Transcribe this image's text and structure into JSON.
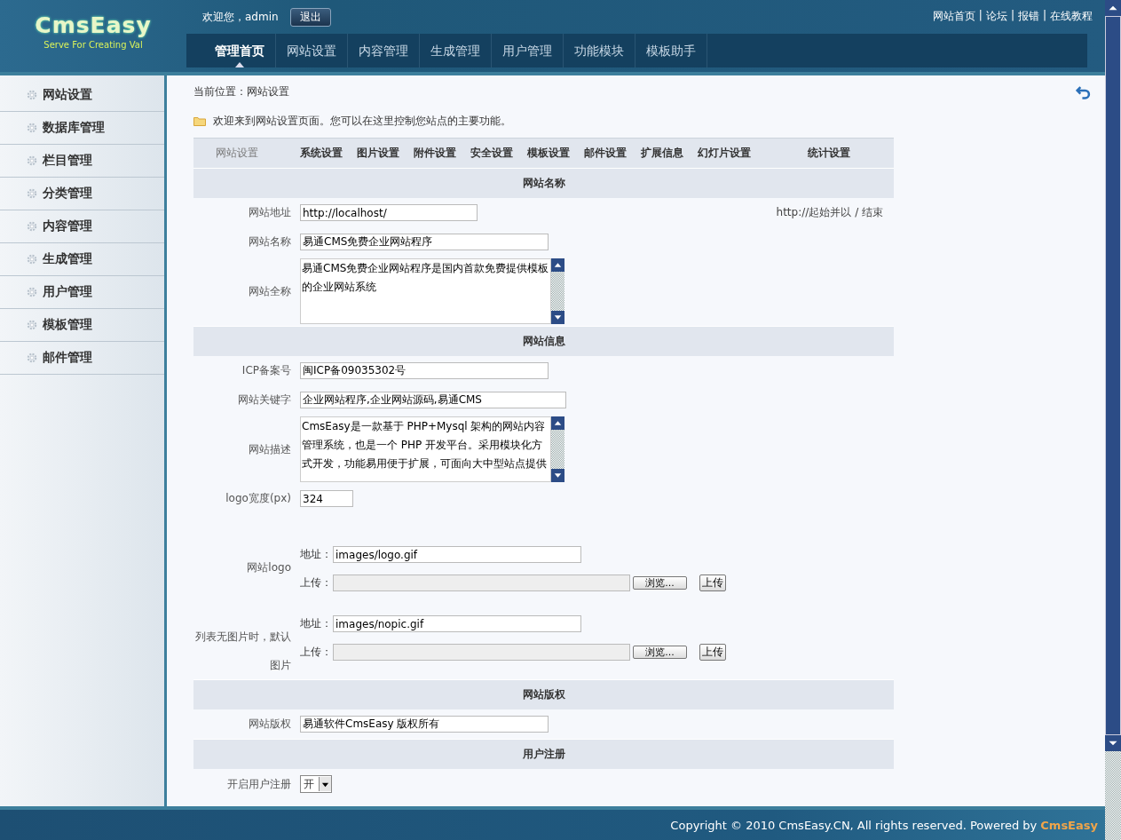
{
  "logo": {
    "name": "CmsEasy",
    "slogan": "Serve For Creating Val"
  },
  "user_bar": {
    "greeting": "欢迎您，admin",
    "logout": "退出"
  },
  "top_links": {
    "separator": "|",
    "items": [
      "网站首页",
      "论坛",
      "报错",
      "在线教程"
    ]
  },
  "main_nav": [
    {
      "label": "管理首页",
      "selected": true
    },
    {
      "label": "网站设置",
      "selected": false
    },
    {
      "label": "内容管理",
      "selected": false
    },
    {
      "label": "生成管理",
      "selected": false
    },
    {
      "label": "用户管理",
      "selected": false
    },
    {
      "label": "功能模块",
      "selected": false
    },
    {
      "label": "模板助手",
      "selected": false
    }
  ],
  "sidebar": {
    "items": [
      "网站设置",
      "数据库管理",
      "栏目管理",
      "分类管理",
      "内容管理",
      "生成管理",
      "用户管理",
      "模板管理",
      "邮件管理"
    ]
  },
  "breadcrumb": "当前位置：网站设置",
  "intro": "欢迎来到网站设置页面。您可以在这里控制您站点的主要功能。",
  "settings_tabs": [
    {
      "label": "网站设置",
      "selected": true
    },
    {
      "label": "系统设置",
      "selected": false
    },
    {
      "label": "图片设置",
      "selected": false
    },
    {
      "label": "附件设置",
      "selected": false
    },
    {
      "label": "安全设置",
      "selected": false
    },
    {
      "label": "模板设置",
      "selected": false
    },
    {
      "label": "邮件设置",
      "selected": false
    },
    {
      "label": "扩展信息",
      "selected": false
    },
    {
      "label": "幻灯片设置",
      "selected": false
    },
    {
      "label": "统计设置",
      "selected": false
    }
  ],
  "sections": [
    {
      "title": "网站名称",
      "rows": [
        {
          "kind": "url",
          "label": "网站地址",
          "value": "http://localhost/",
          "hint": "http://起始并以 / 结束"
        },
        {
          "kind": "text",
          "label": "网站名称",
          "value": "易通CMS免费企业网站程序"
        },
        {
          "kind": "textarea",
          "label": "网站全称",
          "value": "易通CMS免费企业网站程序是国内首款免费提供模板的企业网站系统"
        }
      ]
    },
    {
      "title": "网站信息",
      "rows": [
        {
          "kind": "text",
          "label": "ICP备案号",
          "value": "闽ICP备09035302号"
        },
        {
          "kind": "wide",
          "label": "网站关键字",
          "value": "企业网站程序,企业网站源码,易通CMS"
        },
        {
          "kind": "textarea",
          "label": "网站描述",
          "value": "CmsEasy是一款基于 PHP+Mysql 架构的网站内容管理系统，也是一个 PHP 开发平台。采用模块化方式开发，功能易用便于扩展，可面向大中型站点提供"
        },
        {
          "kind": "number",
          "label": "logo宽度(px)",
          "value": "324"
        },
        {
          "kind": "image",
          "label": "网站logo",
          "address_label": "地址：",
          "value": "images/logo.gif",
          "upload_label": "上传：",
          "browse": "浏览...",
          "upload": "上传"
        },
        {
          "kind": "image",
          "label": "列表无图片时，默认图片",
          "address_label": "地址：",
          "value": "images/nopic.gif",
          "upload_label": "上传：",
          "browse": "浏览...",
          "upload": "上传"
        }
      ]
    },
    {
      "title": "网站版权",
      "rows": [
        {
          "kind": "text",
          "label": "网站版权",
          "value": "易通软件CmsEasy 版权所有"
        }
      ]
    },
    {
      "title": "用户注册",
      "rows": [
        {
          "kind": "select",
          "label": "开启用户注册",
          "value": "开"
        }
      ]
    }
  ],
  "footer": {
    "text": "Copyright © 2010 CmsEasy.CN, All rights reserved. Powered by",
    "link": "CmsEasy"
  }
}
